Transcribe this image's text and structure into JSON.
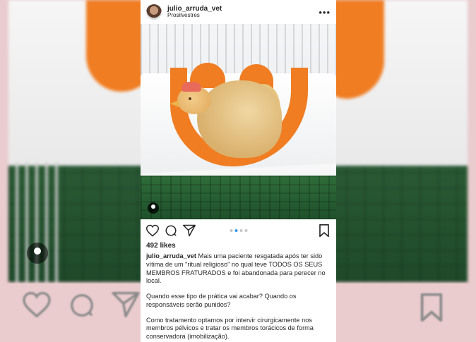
{
  "post": {
    "username": "julio_arruda_vet",
    "location": "Prosilvestres",
    "more_icon": "more-options-icon",
    "likes": "492 likes",
    "carousel": {
      "total": 4,
      "active_index": 1
    },
    "caption_user": "julio_arruda_vet",
    "caption_paragraph_1": "Mais uma paciente resgatada após ter sido vítima de um \"ritual religioso\" no qual teve TODOS OS SEUS MEMBROS FRATURADOS e foi abandonada para perecer no local.",
    "caption_paragraph_2": "Quando esse tipo de prática vai acabar? Quando os responsáveis serão punidos?",
    "caption_paragraph_3": "Como tratamento optamos por intervir cirurgicamente nos membros pélvicos e tratar os membros torácicos de forma conservadora (imobilização)."
  },
  "colors": {
    "backdrop": "#e9d3d3",
    "accent_dot": "#3897f0",
    "pillow": "#f07d22",
    "mat": "#2f6d3a"
  }
}
